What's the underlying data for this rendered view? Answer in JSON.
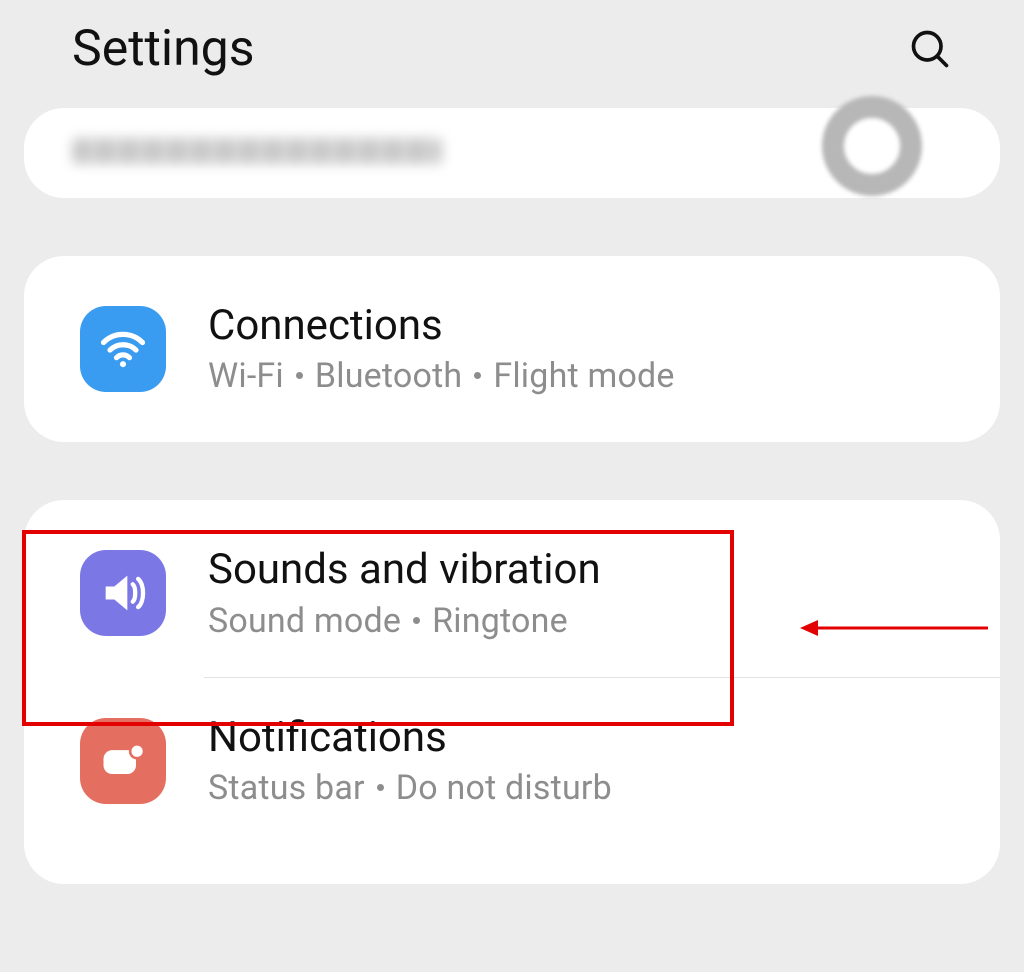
{
  "header": {
    "title": "Settings"
  },
  "groups": [
    {
      "items": [
        {
          "id": "connections",
          "title": "Connections",
          "sub": [
            "Wi-Fi",
            "Bluetooth",
            "Flight mode"
          ],
          "icon": "wifi-icon",
          "color": "blue"
        }
      ]
    },
    {
      "items": [
        {
          "id": "sounds",
          "title": "Sounds and vibration",
          "sub": [
            "Sound mode",
            "Ringtone"
          ],
          "icon": "speaker-icon",
          "color": "purple",
          "highlighted": true
        },
        {
          "id": "notifications",
          "title": "Notifications",
          "sub": [
            "Status bar",
            "Do not disturb"
          ],
          "icon": "notification-icon",
          "color": "red"
        }
      ]
    }
  ]
}
